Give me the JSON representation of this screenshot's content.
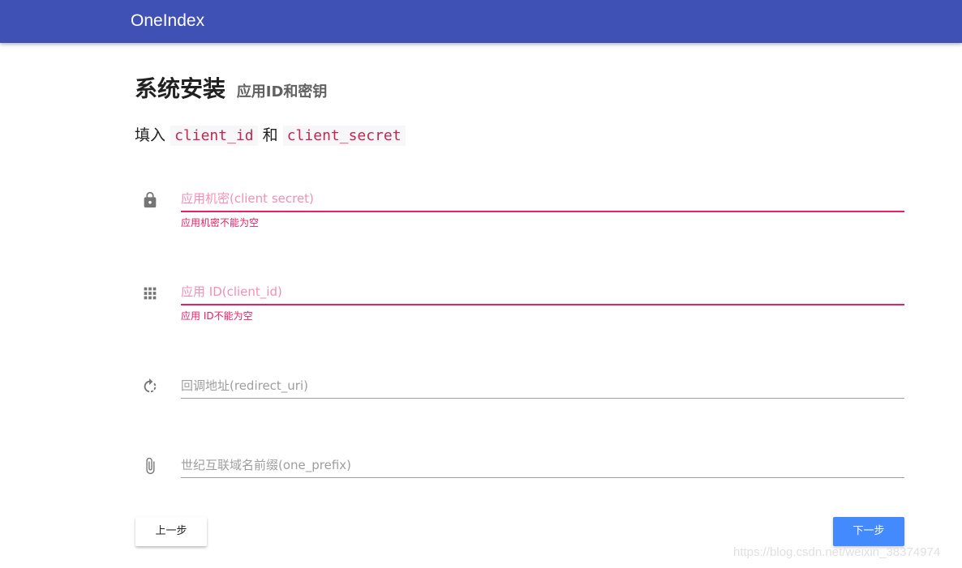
{
  "app": {
    "title": "OneIndex"
  },
  "page": {
    "title": "系统安装",
    "subtitle": "应用ID和密钥",
    "instruction_prefix": "填入",
    "instruction_code1": "client_id",
    "instruction_mid": "和",
    "instruction_code2": "client_secret"
  },
  "form": {
    "client_secret": {
      "icon": "lock-icon",
      "placeholder": "应用机密(client secret)",
      "value": "",
      "error": "应用机密不能为空"
    },
    "client_id": {
      "icon": "apps-grid-icon",
      "placeholder": "应用 ID(client_id)",
      "value": "",
      "error": "应用 ID不能为空"
    },
    "redirect_uri": {
      "icon": "refresh-icon",
      "placeholder": "回调地址(redirect_uri)",
      "value": ""
    },
    "one_prefix": {
      "icon": "paperclip-icon",
      "placeholder": "世纪互联域名前缀(one_prefix)",
      "value": ""
    }
  },
  "buttons": {
    "prev_label": "上一步",
    "next_label": "下一步"
  },
  "watermark": "https://blog.csdn.net/weixin_38374974",
  "colors": {
    "appbar": "#3f51b5",
    "error": "#e91e63",
    "primary_button": "#448aff",
    "code_text": "#c7254e"
  }
}
